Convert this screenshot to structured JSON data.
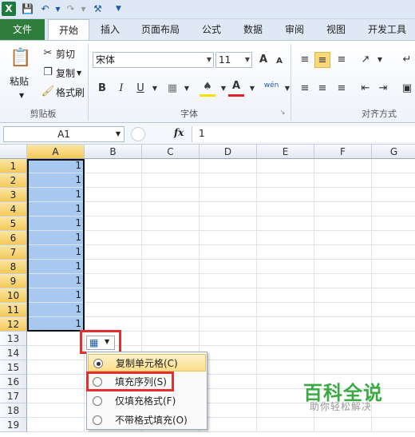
{
  "app": {
    "logo": "X"
  },
  "tabs": [
    "文件",
    "开始",
    "插入",
    "页面布局",
    "公式",
    "数据",
    "审阅",
    "视图",
    "开发工具"
  ],
  "ribbon": {
    "clipboard": {
      "paste": "粘贴",
      "cut": "剪切",
      "copy": "复制",
      "format_painter": "格式刷",
      "label": "剪贴板"
    },
    "font": {
      "name": "宋体",
      "size": "11",
      "label": "字体",
      "bold": "B",
      "italic": "I",
      "underline": "U",
      "grow": "A",
      "shrink": "A",
      "color": "A",
      "wen": "wén"
    },
    "alignment": {
      "label": "对齐方式"
    }
  },
  "formula_bar": {
    "name_box": "A1",
    "fx": "fx",
    "value": "1"
  },
  "grid": {
    "columns": [
      "A",
      "B",
      "C",
      "D",
      "E",
      "F",
      "G"
    ],
    "rows": [
      "1",
      "2",
      "3",
      "4",
      "5",
      "6",
      "7",
      "8",
      "9",
      "10",
      "11",
      "12",
      "13",
      "14",
      "15",
      "16",
      "17",
      "18",
      "19"
    ],
    "a_values": [
      "1",
      "1",
      "1",
      "1",
      "1",
      "1",
      "1",
      "1",
      "1",
      "1",
      "1",
      "1"
    ]
  },
  "autofill_menu": {
    "items": [
      "复制单元格(C)",
      "填充序列(S)",
      "仅填充格式(F)",
      "不带格式填充(O)"
    ],
    "selected_index": 0
  },
  "watermark": {
    "title": "百科全说",
    "subtitle": "助你轻松解决"
  }
}
